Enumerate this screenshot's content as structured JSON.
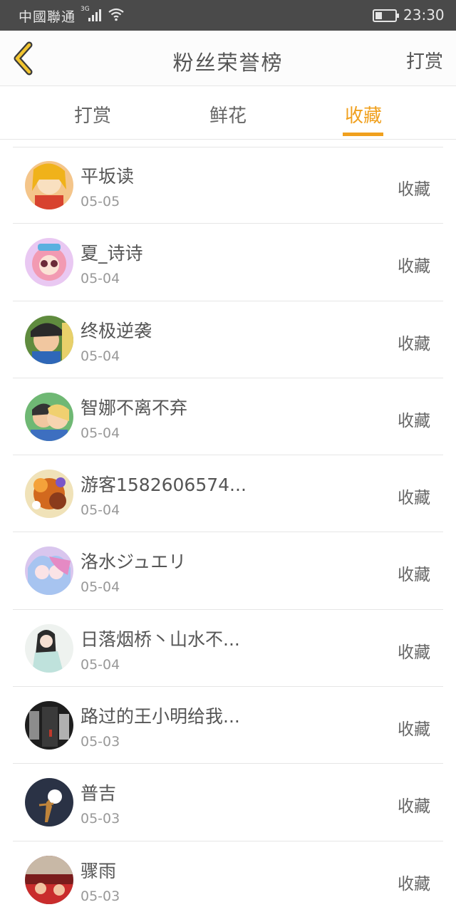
{
  "status_bar": {
    "carrier": "中國聯通",
    "network": "3G",
    "time": "23:30"
  },
  "header": {
    "title": "粉丝荣誉榜",
    "action_label": "打赏",
    "back_icon": "chevron-left-icon"
  },
  "tabs": [
    {
      "label": "打赏",
      "active": false
    },
    {
      "label": "鲜花",
      "active": false
    },
    {
      "label": "收藏",
      "active": true
    }
  ],
  "colors": {
    "accent": "#f0a01e",
    "status_bar_bg": "#4a4a4a",
    "text_primary": "#555555",
    "text_secondary": "#999999",
    "divider": "#e6e6e6"
  },
  "list": [
    {
      "name": "平坂读",
      "date": "05-05",
      "action": "收藏"
    },
    {
      "name": "夏_诗诗",
      "date": "05-04",
      "action": "收藏"
    },
    {
      "name": "终极逆袭",
      "date": "05-04",
      "action": "收藏"
    },
    {
      "name": "智娜不离不弃",
      "date": "05-04",
      "action": "收藏"
    },
    {
      "name": "游客1582606574...",
      "date": "05-04",
      "action": "收藏"
    },
    {
      "name": "洛水ジュエリ",
      "date": "05-04",
      "action": "收藏"
    },
    {
      "name": "日落烟桥丶山水不...",
      "date": "05-04",
      "action": "收藏"
    },
    {
      "name": "路过的王小明给我...",
      "date": "05-03",
      "action": "收藏"
    },
    {
      "name": "普吉",
      "date": "05-03",
      "action": "收藏"
    },
    {
      "name": "骤雨",
      "date": "05-03",
      "action": "收藏"
    }
  ]
}
